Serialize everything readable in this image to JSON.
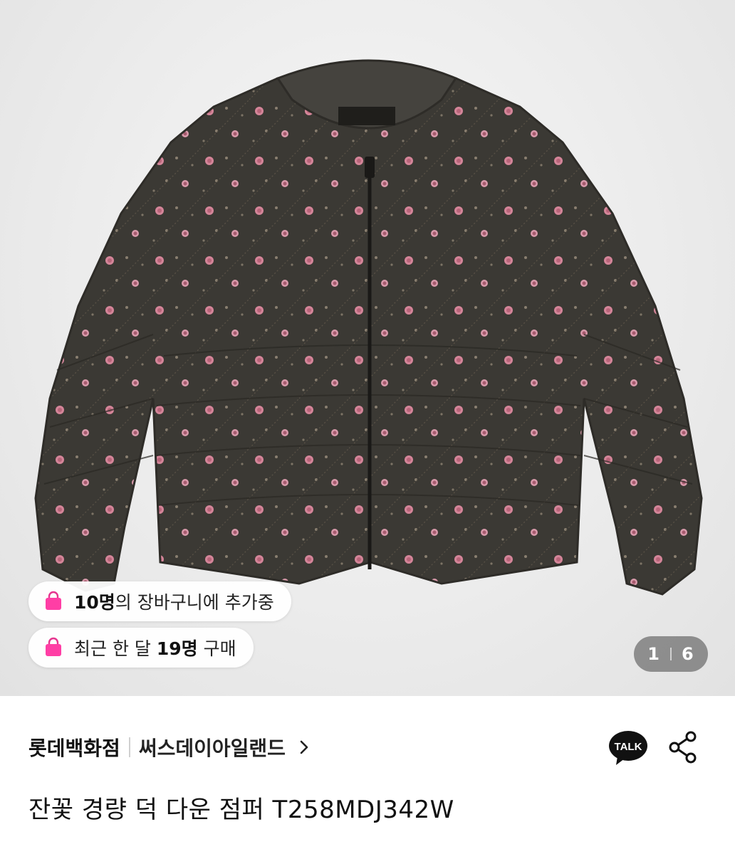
{
  "product_image": {
    "description_icon": "jacket-product-photo"
  },
  "cart_badge": {
    "count": "10명",
    "text": "의 장바구니에 추가중",
    "icon": "shopping-bag-icon"
  },
  "purchase_badge": {
    "prefix": "최근 한 달 ",
    "count": "19명",
    "suffix": " 구매",
    "icon": "shopping-bag-icon"
  },
  "image_counter": {
    "current": "1",
    "total": "6"
  },
  "store": {
    "seller": "롯데백화점",
    "brand": "써스데이아일랜드",
    "chevron_icon": "chevron-right-icon"
  },
  "actions": {
    "talk_label": "TALK",
    "share_icon": "share-icon"
  },
  "product": {
    "title": "잔꽃 경량 덕 다운 점퍼 T258MDJ342W"
  },
  "colors": {
    "jacket": "#3d3b36",
    "flower": "#d98a9c",
    "bag_pink": "#ff3ea5"
  }
}
